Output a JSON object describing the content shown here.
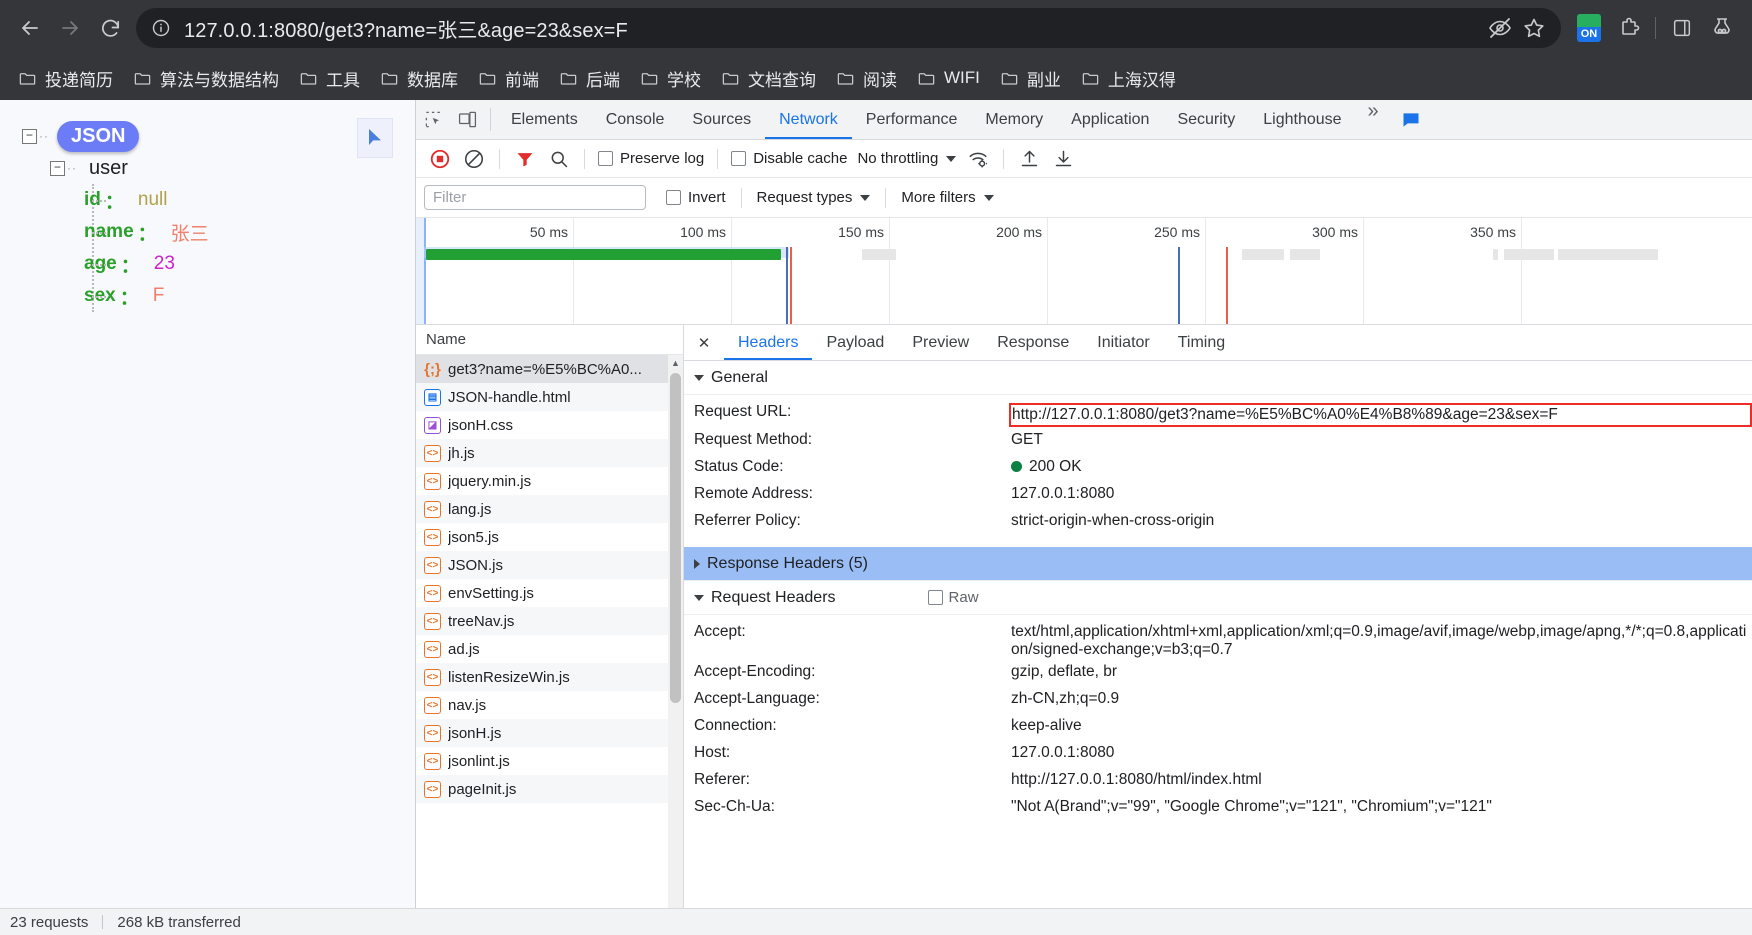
{
  "browser": {
    "url": "127.0.0.1:8080/get3?name=张三&age=23&sex=F",
    "nav": {
      "back": "back-arrow",
      "forward": "forward-arrow",
      "reload": "reload"
    },
    "omnibox_icons": [
      "no-view-icon",
      "star-icon"
    ],
    "extension_badge": "ON",
    "bookmarks": [
      {
        "label": "投递简历"
      },
      {
        "label": "算法与数据结构"
      },
      {
        "label": "工具"
      },
      {
        "label": "数据库"
      },
      {
        "label": "前端"
      },
      {
        "label": "后端"
      },
      {
        "label": "学校"
      },
      {
        "label": "文档查询"
      },
      {
        "label": "阅读"
      },
      {
        "label": "WIFI"
      },
      {
        "label": "副业"
      },
      {
        "label": "上海汉得"
      }
    ]
  },
  "json_viewer": {
    "root_badge": "JSON",
    "root_node": "user",
    "entries": [
      {
        "key": "id",
        "colon": "：",
        "value": "null",
        "kind": "null"
      },
      {
        "key": "name",
        "colon": "：",
        "value": "张三",
        "kind": "str-cn"
      },
      {
        "key": "age",
        "colon": "：",
        "value": "23",
        "kind": "num"
      },
      {
        "key": "sex",
        "colon": "：",
        "value": "F",
        "kind": "str"
      }
    ],
    "collapse_glyph": "−"
  },
  "devtools": {
    "panels": [
      {
        "label": "Elements",
        "active": false
      },
      {
        "label": "Console",
        "active": false
      },
      {
        "label": "Sources",
        "active": false
      },
      {
        "label": "Network",
        "active": true
      },
      {
        "label": "Performance",
        "active": false
      },
      {
        "label": "Memory",
        "active": false
      },
      {
        "label": "Application",
        "active": false
      },
      {
        "label": "Security",
        "active": false
      },
      {
        "label": "Lighthouse",
        "active": false
      }
    ],
    "more_panels_glyph": "»",
    "toolbar": {
      "record_title": "record-stop",
      "clear_title": "clear",
      "filter_title": "filter",
      "search_title": "search",
      "preserve_log": "Preserve log",
      "disable_cache": "Disable cache",
      "throttling": "No throttling",
      "wifi_title": "network-conditions",
      "import_title": "import-har",
      "export_title": "export-har"
    },
    "filterbar": {
      "filter_placeholder": "Filter",
      "filter_value": "",
      "invert": "Invert",
      "request_types": "Request types",
      "more_filters": "More filters"
    },
    "overview": {
      "ticks": [
        "50 ms",
        "100 ms",
        "150 ms",
        "200 ms",
        "250 ms",
        "300 ms",
        "350 ms"
      ],
      "bar_color": "#22a033",
      "dom_content_loaded_color": "#4a6fb5",
      "load_color": "#e8604c"
    },
    "requests": {
      "column_header": "Name",
      "rows": [
        {
          "name": "get3?name=%E5%BC%A0...",
          "type": "json",
          "glyph": "{;}",
          "selected": true
        },
        {
          "name": "JSON-handle.html",
          "type": "html",
          "glyph": "▤",
          "selected": false
        },
        {
          "name": "jsonH.css",
          "type": "css",
          "glyph": "◪",
          "selected": false
        },
        {
          "name": "jh.js",
          "type": "js",
          "glyph": "<>",
          "selected": false
        },
        {
          "name": "jquery.min.js",
          "type": "js",
          "glyph": "<>",
          "selected": false
        },
        {
          "name": "lang.js",
          "type": "js",
          "glyph": "<>",
          "selected": false
        },
        {
          "name": "json5.js",
          "type": "js",
          "glyph": "<>",
          "selected": false
        },
        {
          "name": "JSON.js",
          "type": "js",
          "glyph": "<>",
          "selected": false
        },
        {
          "name": "envSetting.js",
          "type": "js",
          "glyph": "<>",
          "selected": false
        },
        {
          "name": "treeNav.js",
          "type": "js",
          "glyph": "<>",
          "selected": false
        },
        {
          "name": "ad.js",
          "type": "js",
          "glyph": "<>",
          "selected": false
        },
        {
          "name": "listenResizeWin.js",
          "type": "js",
          "glyph": "<>",
          "selected": false
        },
        {
          "name": "nav.js",
          "type": "js",
          "glyph": "<>",
          "selected": false
        },
        {
          "name": "jsonH.js",
          "type": "js",
          "glyph": "<>",
          "selected": false
        },
        {
          "name": "jsonlint.js",
          "type": "js",
          "glyph": "<>",
          "selected": false
        },
        {
          "name": "pageInit.js",
          "type": "js",
          "glyph": "<>",
          "selected": false
        }
      ]
    },
    "status_bar": {
      "requests": "23 requests",
      "transferred": "268 kB transferred"
    },
    "detail": {
      "tabs": [
        {
          "label": "Headers",
          "active": true
        },
        {
          "label": "Payload",
          "active": false
        },
        {
          "label": "Preview",
          "active": false
        },
        {
          "label": "Response",
          "active": false
        },
        {
          "label": "Initiator",
          "active": false
        },
        {
          "label": "Timing",
          "active": false
        }
      ],
      "close_glyph": "✕",
      "general_section": "General",
      "general": [
        {
          "key": "Request URL:",
          "value": "http://127.0.0.1:8080/get3?name=%E5%BC%A0%E4%B8%89&age=23&sex=F",
          "highlight": true
        },
        {
          "key": "Request Method:",
          "value": "GET"
        },
        {
          "key": "Status Code:",
          "value": "200 OK",
          "status": true
        },
        {
          "key": "Remote Address:",
          "value": "127.0.0.1:8080"
        },
        {
          "key": "Referrer Policy:",
          "value": "strict-origin-when-cross-origin"
        }
      ],
      "response_headers_section": "Response Headers (5)",
      "request_headers_section": "Request Headers",
      "raw_label": "Raw",
      "request_headers": [
        {
          "key": "Accept:",
          "value": "text/html,application/xhtml+xml,application/xml;q=0.9,image/avif,image/webp,image/apng,*/*;q=0.8,application/signed-exchange;v=b3;q=0.7"
        },
        {
          "key": "Accept-Encoding:",
          "value": "gzip, deflate, br"
        },
        {
          "key": "Accept-Language:",
          "value": "zh-CN,zh;q=0.9"
        },
        {
          "key": "Connection:",
          "value": "keep-alive"
        },
        {
          "key": "Host:",
          "value": "127.0.0.1:8080"
        },
        {
          "key": "Referer:",
          "value": "http://127.0.0.1:8080/html/index.html"
        },
        {
          "key": "Sec-Ch-Ua:",
          "value": "\"Not A(Brand\";v=\"99\", \"Google Chrome\";v=\"121\", \"Chromium\";v=\"121\""
        }
      ]
    }
  }
}
